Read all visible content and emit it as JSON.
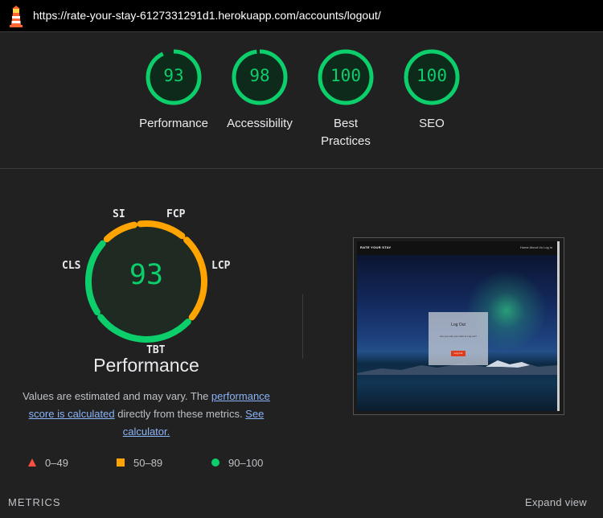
{
  "header": {
    "url": "https://rate-your-stay-6127331291d1.herokuapp.com/accounts/logout/",
    "logo_icon": "lighthouse-icon"
  },
  "category_gauges": [
    {
      "score": "93",
      "label": "Performance",
      "fraction": 0.93
    },
    {
      "score": "98",
      "label": "Accessibility",
      "fraction": 0.98
    },
    {
      "score": "100",
      "label": "Best Practices",
      "fraction": 1.0
    },
    {
      "score": "100",
      "label": "SEO",
      "fraction": 1.0
    }
  ],
  "performance": {
    "score": "93",
    "title": "Performance",
    "metric_labels": {
      "si": "SI",
      "fcp": "FCP",
      "lcp": "LCP",
      "tbt": "TBT",
      "cls": "CLS"
    },
    "description": {
      "part1": "Values are estimated and may vary. The ",
      "link1": "performance score is calculated",
      "part2": " directly from these metrics. ",
      "link2": "See calculator."
    }
  },
  "legend": [
    {
      "range": "0–49",
      "icon": "triangle-icon",
      "color": "#ff4e42"
    },
    {
      "range": "50–89",
      "icon": "square-icon",
      "color": "#ffa400"
    },
    {
      "range": "90–100",
      "icon": "circle-icon",
      "color": "#0cce6b"
    }
  ],
  "screenshot": {
    "brand": "RATE YOUR STAY",
    "nav_links": "Home  About Us  Log in",
    "card_title": "Log Out",
    "card_text": "Are you sure you want to Log out?",
    "card_button": "Log Out"
  },
  "footer": {
    "metrics_label": "METRICS",
    "expand_label": "Expand view"
  },
  "colors": {
    "pass": "#0cce6b",
    "average": "#ffa400",
    "fail": "#ff4e42",
    "background": "#212121"
  }
}
